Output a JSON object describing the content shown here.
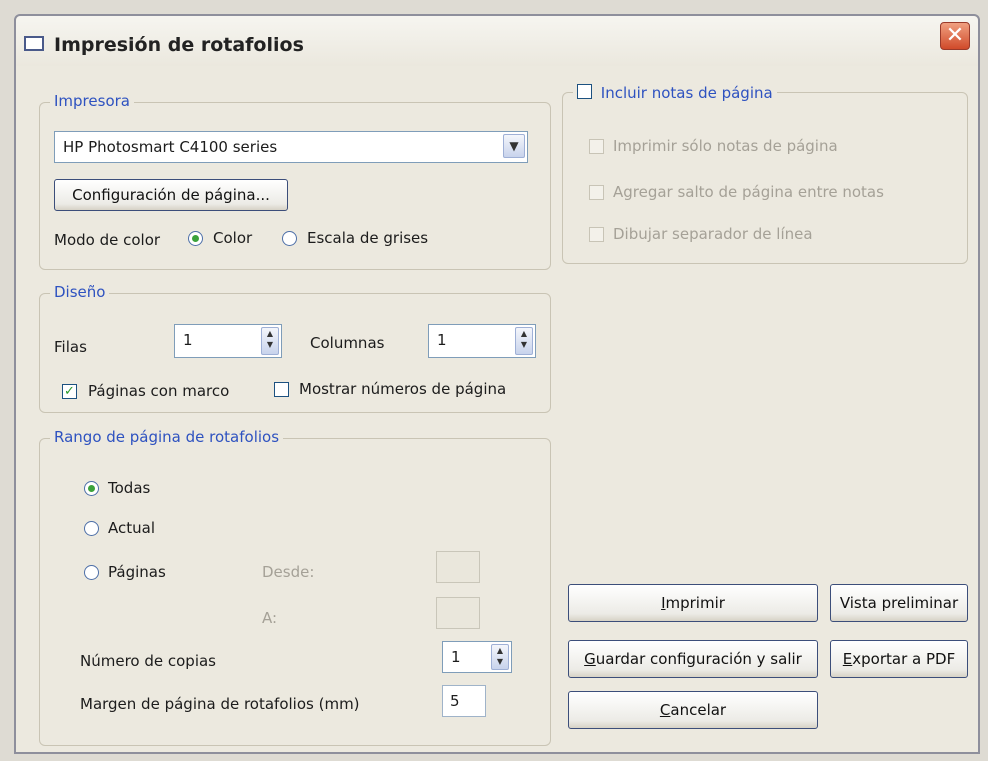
{
  "window": {
    "title": "Impresión de rotafolios",
    "close_glyph": "✕"
  },
  "printer": {
    "legend": "Impresora",
    "selected": "HP Photosmart C4100 series",
    "page_setup_label": "Configuración de página...",
    "color_mode_label": "Modo de color",
    "color_label": "Color",
    "grayscale_label": "Escala de grises"
  },
  "notes": {
    "include_label": "Incluir notas de página",
    "print_only_label": "Imprimir sólo notas de página",
    "page_break_label": "Agregar salto de página entre notas",
    "separator_label": "Dibujar separador de línea"
  },
  "design": {
    "legend": "Diseño",
    "rows_label": "Filas",
    "rows_value": "1",
    "columns_label": "Columnas",
    "columns_value": "1",
    "framed_label": "Páginas con marco",
    "show_numbers_label": "Mostrar números de página"
  },
  "range": {
    "legend": "Rango de página de rotafolios",
    "all_label": "Todas",
    "current_label": "Actual",
    "pages_label": "Páginas",
    "from_label": "Desde:",
    "to_label": "A:",
    "copies_label": "Número de copias",
    "copies_value": "1",
    "margin_label": "Margen de página de rotafolios (mm)",
    "margin_value": "5"
  },
  "buttons": {
    "print_first": "I",
    "print_rest": "mprimir",
    "preview": "Vista preliminar",
    "save_first": "G",
    "save_rest": "uardar configuración y salir",
    "export_first": "E",
    "export_rest": "xportar a PDF",
    "cancel_first": "C",
    "cancel_rest": "ancelar"
  }
}
